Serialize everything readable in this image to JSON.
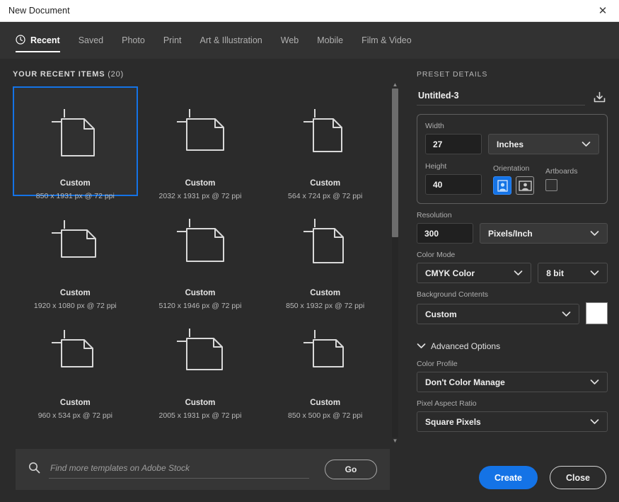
{
  "window": {
    "title": "New Document",
    "close_icon": "close-icon"
  },
  "tabs": [
    {
      "label": "Recent",
      "icon": "clock-icon",
      "active": true
    },
    {
      "label": "Saved",
      "active": false
    },
    {
      "label": "Photo",
      "active": false
    },
    {
      "label": "Print",
      "active": false
    },
    {
      "label": "Art & Illustration",
      "active": false
    },
    {
      "label": "Web",
      "active": false
    },
    {
      "label": "Mobile",
      "active": false
    },
    {
      "label": "Film & Video",
      "active": false
    }
  ],
  "recent": {
    "heading": "YOUR RECENT ITEMS",
    "count": "(20)",
    "items": [
      {
        "title": "Custom",
        "dimensions": "850 x 1931 px @ 72 ppi",
        "selected": true,
        "icon": "document-portrait-icon"
      },
      {
        "title": "Custom",
        "dimensions": "2032 x 1931 px @ 72 ppi",
        "selected": false,
        "icon": "document-landscape-icon"
      },
      {
        "title": "Custom",
        "dimensions": "564 x 724 px @ 72 ppi",
        "selected": false,
        "icon": "document-portrait-icon"
      },
      {
        "title": "Custom",
        "dimensions": "1920 x 1080 px @ 72 ppi",
        "selected": false,
        "icon": "document-landscape-icon"
      },
      {
        "title": "Custom",
        "dimensions": "5120 x 1946 px @ 72 ppi",
        "selected": false,
        "icon": "document-landscape-icon"
      },
      {
        "title": "Custom",
        "dimensions": "850 x 1932 px @ 72 ppi",
        "selected": false,
        "icon": "document-portrait-icon"
      },
      {
        "title": "Custom",
        "dimensions": "960 x 534 px @ 72 ppi",
        "selected": false,
        "icon": "document-landscape-icon"
      },
      {
        "title": "Custom",
        "dimensions": "2005 x 1931 px @ 72 ppi",
        "selected": false,
        "icon": "document-landscape-icon"
      },
      {
        "title": "Custom",
        "dimensions": "850 x 500 px @ 72 ppi",
        "selected": false,
        "icon": "document-landscape-icon"
      }
    ]
  },
  "stock": {
    "placeholder": "Find more templates on Adobe Stock",
    "value": "",
    "search_icon": "search-icon",
    "go_label": "Go"
  },
  "preset": {
    "heading": "PRESET DETAILS",
    "name_value": "Untitled-3",
    "save_icon": "save-preset-icon",
    "width": {
      "label": "Width",
      "value": "27",
      "unit": "Inches"
    },
    "height": {
      "label": "Height",
      "value": "40"
    },
    "orientation": {
      "label": "Orientation",
      "portrait_icon": "orientation-portrait-icon",
      "landscape_icon": "orientation-landscape-icon",
      "selected": "portrait"
    },
    "artboards": {
      "label": "Artboards",
      "checked": false
    },
    "resolution": {
      "label": "Resolution",
      "value": "300",
      "unit": "Pixels/Inch"
    },
    "color_mode": {
      "label": "Color Mode",
      "value": "CMYK Color",
      "depth": "8 bit"
    },
    "background": {
      "label": "Background Contents",
      "value": "Custom",
      "swatch_color": "#ffffff"
    },
    "advanced": {
      "label": "Advanced Options",
      "expanded": true,
      "chevron_icon": "chevron-down-icon"
    },
    "color_profile": {
      "label": "Color Profile",
      "value": "Don't Color Manage"
    },
    "pixel_aspect_ratio": {
      "label": "Pixel Aspect Ratio",
      "value": "Square Pixels"
    }
  },
  "footer": {
    "create_label": "Create",
    "close_label": "Close"
  },
  "colors": {
    "accent": "#1473e6",
    "dialog_bg": "#2b2b2b",
    "tabbar_bg": "#323232",
    "titlebar_bg": "#ffffff"
  }
}
